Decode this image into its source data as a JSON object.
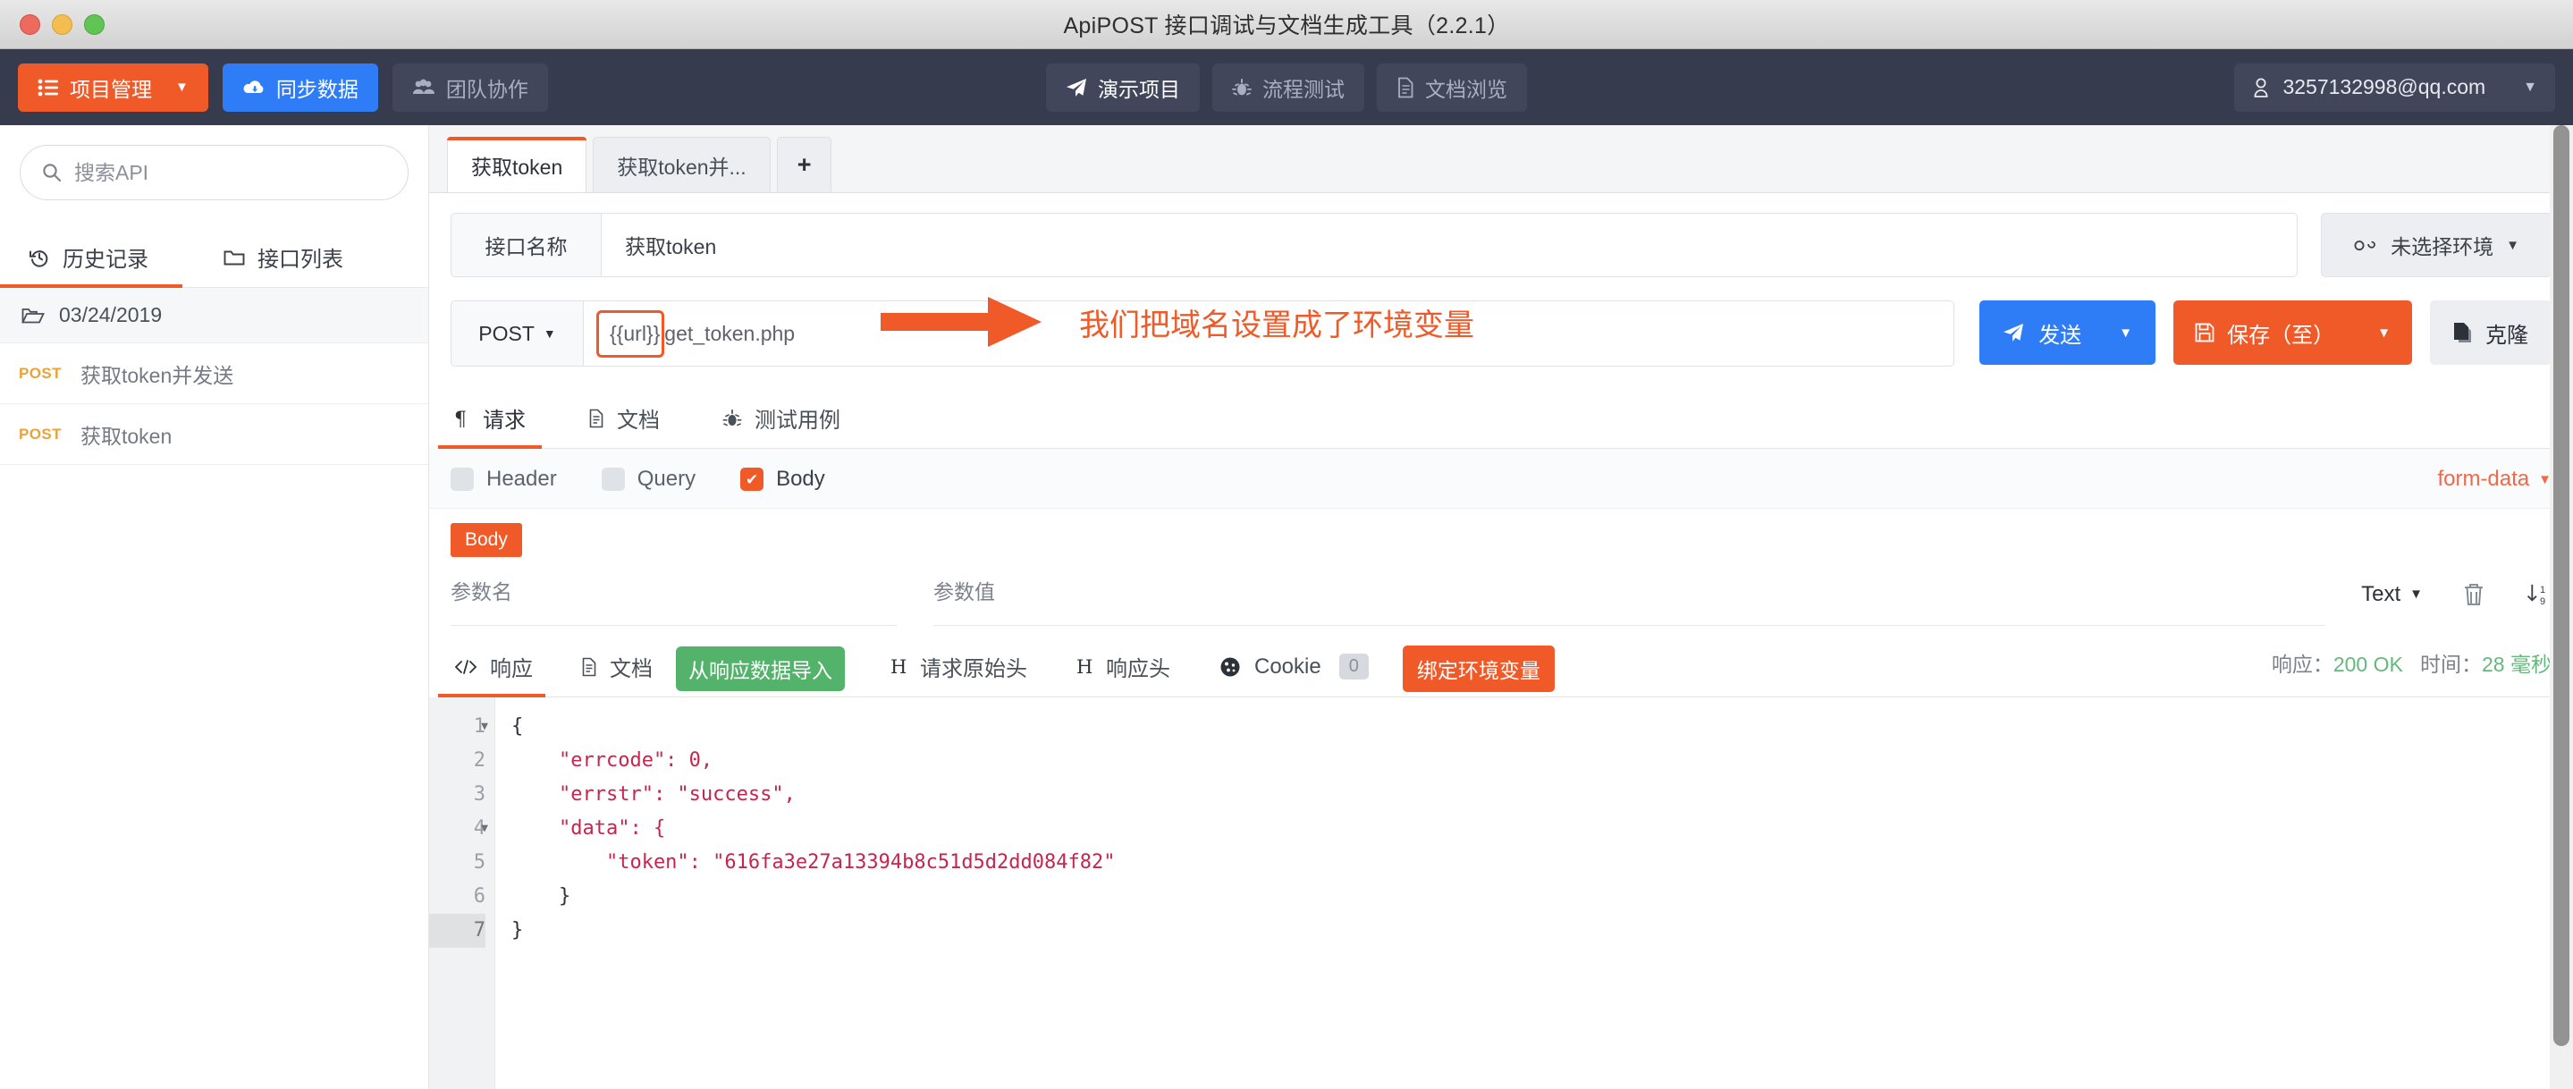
{
  "window": {
    "title": "ApiPOST 接口调试与文档生成工具（2.2.1）"
  },
  "toolbar": {
    "project_manage": "项目管理",
    "sync_data": "同步数据",
    "team_collab": "团队协作",
    "demo_project": "演示项目",
    "flow_test": "流程测试",
    "doc_browse": "文档浏览",
    "user_email": "3257132998@qq.com"
  },
  "sidebar": {
    "search_placeholder": "搜索API",
    "tabs": [
      {
        "label": "历史记录",
        "active": true
      },
      {
        "label": "接口列表",
        "active": false
      }
    ],
    "folder": "03/24/2019",
    "items": [
      {
        "method": "POST",
        "name": "获取token并发送"
      },
      {
        "method": "POST",
        "name": "获取token"
      }
    ]
  },
  "doc_tabs": [
    {
      "label": "获取token",
      "active": true
    },
    {
      "label": "获取token并...",
      "active": false
    }
  ],
  "add_tab_label": "+",
  "request": {
    "name_label": "接口名称",
    "name_value": "获取token",
    "env_selector": "未选择环境",
    "method": "POST",
    "url_variable": "{{url}}",
    "url_path": "get_token.php",
    "send_label": "发送",
    "save_label": "保存（至）",
    "clone_label": "克隆"
  },
  "annotation": {
    "text": "我们把域名设置成了环境变量",
    "color": "#f05a28"
  },
  "request_tabs": [
    {
      "label": "请求",
      "icon": "pilcrow-icon",
      "active": true
    },
    {
      "label": "文档",
      "icon": "document-icon",
      "active": false
    },
    {
      "label": "测试用例",
      "icon": "bug-icon",
      "active": false
    }
  ],
  "body_section": {
    "checkboxes": [
      {
        "label": "Header",
        "checked": false
      },
      {
        "label": "Query",
        "checked": false
      },
      {
        "label": "Body",
        "checked": true
      }
    ],
    "content_type": "form-data",
    "body_pill": "Body",
    "param_name_header": "参数名",
    "param_value_header": "参数值",
    "param_type": "Text"
  },
  "response_tabs": [
    {
      "label": "响应",
      "icon": "code-icon",
      "active": true
    },
    {
      "label": "文档",
      "icon": "document-icon",
      "active": false
    },
    {
      "label": "请求原始头",
      "icon": "h-icon",
      "active": false
    },
    {
      "label": "响应头",
      "icon": "h-icon",
      "active": false
    },
    {
      "label": "Cookie",
      "icon": "cookie-icon",
      "active": false,
      "count": "0"
    }
  ],
  "import_from_response": "从响应数据导入",
  "bind_env_var": "绑定环境变量",
  "response_status": {
    "label": "响应：",
    "code": "200 OK",
    "time_label": "时间：",
    "time": "28 毫秒"
  },
  "code": {
    "lines": [
      {
        "n": "1",
        "fold": true,
        "text": "{"
      },
      {
        "n": "2",
        "fold": false,
        "text": "    \"errcode\": 0,"
      },
      {
        "n": "3",
        "fold": false,
        "text": "    \"errstr\": \"success\","
      },
      {
        "n": "4",
        "fold": true,
        "text": "    \"data\": {"
      },
      {
        "n": "5",
        "fold": false,
        "text": "        \"token\": \"616fa3e27a13394b8c51d5d2dd084f82\""
      },
      {
        "n": "6",
        "fold": false,
        "text": "    }"
      },
      {
        "n": "7",
        "fold": false,
        "text": "}",
        "current": true
      }
    ]
  },
  "colors": {
    "accent_orange": "#f05a28",
    "accent_blue": "#2f7df6",
    "accent_green": "#54b36a",
    "toolbar_dark": "#363b4d"
  }
}
